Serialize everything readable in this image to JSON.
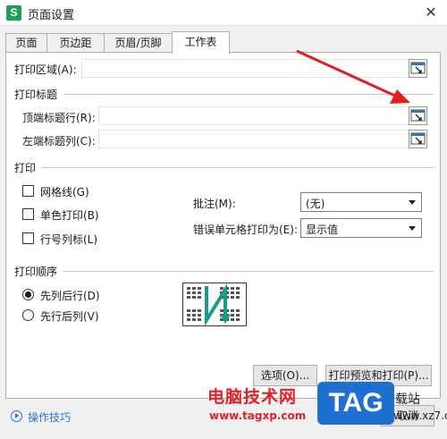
{
  "window": {
    "app_icon_letter": "S",
    "title": "页面设置",
    "close_glyph": "✕"
  },
  "tabs": [
    {
      "label": "页面"
    },
    {
      "label": "页边距"
    },
    {
      "label": "页眉/页脚"
    },
    {
      "label": "工作表"
    }
  ],
  "print_area": {
    "label": "打印区域(A):",
    "value": ""
  },
  "print_titles": {
    "section": "打印标题",
    "top_rows_label": "顶端标题行(R):",
    "top_rows_value": "",
    "left_cols_label": "左端标题列(C):",
    "left_cols_value": ""
  },
  "print": {
    "section": "打印",
    "gridlines": "网格线(G)",
    "mono": "单色打印(B)",
    "row_col_headers": "行号列标(L)",
    "comments_label": "批注(M):",
    "comments_value": "(无)",
    "errors_label": "错误单元格打印为(E):",
    "errors_value": "显示值"
  },
  "print_order": {
    "section": "打印顺序",
    "down_then_over": "先列后行(D)",
    "over_then_down": "先行后列(V)",
    "selected": "down_then_over"
  },
  "buttons": {
    "options": "选项(O)...",
    "print_preview": "打印预览和打印(P)...",
    "cancel": "取消"
  },
  "footer": {
    "tips": "操作技巧"
  },
  "watermark": {
    "cn": "电脑技术网",
    "url": "www.tagxp.com",
    "logo": "TAG",
    "side1": "载站",
    "side2": "www.xz7.com"
  },
  "colors": {
    "accent_arrow": "#e02020",
    "link": "#2a78c8",
    "app_icon": "#1f9e57"
  },
  "icons": {
    "range_picker": "range-picker-icon",
    "tips": "play-circle-icon"
  }
}
